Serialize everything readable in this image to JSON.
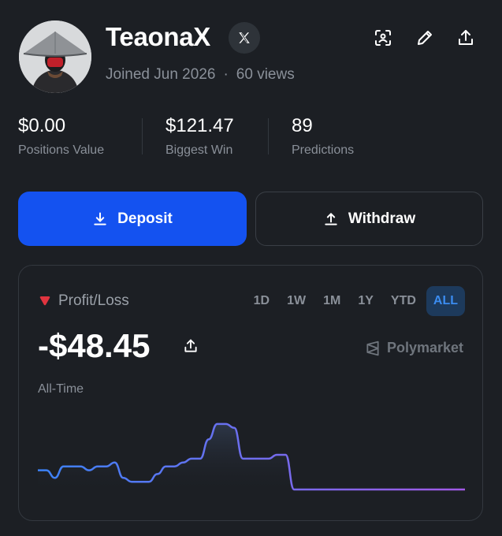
{
  "profile": {
    "username": "TeaonaX",
    "joined": "Joined Jun 2026",
    "views": "60 views",
    "dot": "·",
    "x_icon": "x-logo-icon"
  },
  "header_icons": [
    "face-scan-icon",
    "pencil-icon",
    "share-icon"
  ],
  "stats": [
    {
      "value": "$0.00",
      "label": "Positions Value"
    },
    {
      "value": "$121.47",
      "label": "Biggest Win"
    },
    {
      "value": "89",
      "label": "Predictions"
    }
  ],
  "actions": {
    "deposit": "Deposit",
    "withdraw": "Withdraw"
  },
  "pnl": {
    "label": "Profit/Loss",
    "value": "-$48.45",
    "period_label": "All-Time",
    "brand": "Polymarket",
    "tabs": [
      "1D",
      "1W",
      "1M",
      "1Y",
      "YTD",
      "ALL"
    ],
    "active_tab": "ALL",
    "indicator_color": "#e0343f"
  },
  "colors": {
    "background": "#1c1f24",
    "accent": "#1452f0",
    "line_start": "#3b82f6",
    "line_end": "#a259e6"
  },
  "chart_data": {
    "type": "line",
    "values": [
      55,
      55,
      53,
      56,
      56,
      56,
      55,
      56,
      56,
      57,
      53,
      52,
      52,
      52,
      54,
      56,
      56,
      57,
      58,
      58,
      63,
      67,
      67,
      66,
      58,
      58,
      58,
      58,
      59,
      59,
      50,
      50,
      50,
      50,
      50,
      50,
      50,
      50,
      50,
      50,
      50,
      50,
      50,
      50,
      50,
      50,
      50,
      50,
      50,
      50,
      50
    ],
    "ylim": [
      50,
      68
    ]
  }
}
